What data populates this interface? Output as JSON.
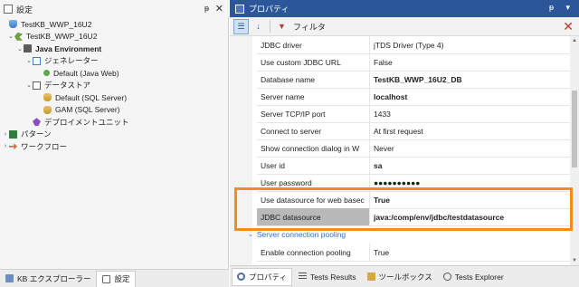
{
  "left": {
    "title": "設定",
    "pin": "ᵽ",
    "close": "✕",
    "tree": [
      {
        "label": "TestKB_WWP_16U2",
        "indent": 0,
        "chevron": "",
        "icon": "db",
        "bold": false
      },
      {
        "label": "TestKB_WWP_16U2",
        "indent": 1,
        "chevron": "⌄",
        "icon": "kbenv",
        "bold": false
      },
      {
        "label": "Java Environment",
        "indent": 2,
        "chevron": "⌄",
        "icon": "java",
        "bold": true
      },
      {
        "label": "ジェネレーター",
        "indent": 3,
        "chevron": "⌄",
        "icon": "gen",
        "bold": false
      },
      {
        "label": "Default (Java Web)",
        "indent": 4,
        "chevron": "",
        "icon": "dotgreen",
        "bold": false
      },
      {
        "label": "データストア",
        "indent": 3,
        "chevron": "⌄",
        "icon": "store",
        "bold": false
      },
      {
        "label": "Default (SQL Server)",
        "indent": 4,
        "chevron": "",
        "icon": "cyl",
        "bold": false
      },
      {
        "label": "GAM (SQL Server)",
        "indent": 4,
        "chevron": "",
        "icon": "cyl",
        "bold": false
      },
      {
        "label": "デプロイメントユニット",
        "indent": 3,
        "chevron": "",
        "icon": "deploy",
        "bold": false
      },
      {
        "label": "パターン",
        "indent": 0,
        "chevron": "›",
        "icon": "pattern",
        "bold": false
      },
      {
        "label": "ワークフロー",
        "indent": 0,
        "chevron": "›",
        "icon": "flow",
        "bold": false
      }
    ],
    "tabs": [
      {
        "label": "KB エクスプローラー",
        "active": false
      },
      {
        "label": "設定",
        "active": true
      }
    ]
  },
  "right": {
    "title": "プロパティ",
    "pin": "ᵽ",
    "dropdown": "▾",
    "toolbar": {
      "filter_label": "フィルタ",
      "close": "✕"
    },
    "rows": [
      {
        "name": "JDBC driver",
        "value": "jTDS Driver (Type 4)",
        "bold": false,
        "selected": false
      },
      {
        "name": "Use custom JDBC URL",
        "value": "False",
        "bold": false,
        "selected": false
      },
      {
        "name": "Database name",
        "value": "TestKB_WWP_16U2_DB",
        "bold": true,
        "selected": false
      },
      {
        "name": "Server name",
        "value": "localhost",
        "bold": true,
        "selected": false
      },
      {
        "name": "Server TCP/IP port",
        "value": "1433",
        "bold": false,
        "selected": false
      },
      {
        "name": "Connect to server",
        "value": "At first request",
        "bold": false,
        "selected": false
      },
      {
        "name": "Show connection dialog in W",
        "value": "Never",
        "bold": false,
        "selected": false
      },
      {
        "name": "User id",
        "value": "sa",
        "bold": true,
        "selected": false
      },
      {
        "name": "User password",
        "value": "●●●●●●●●●●",
        "bold": true,
        "selected": false
      },
      {
        "name": "Use datasource for web basec",
        "value": "True",
        "bold": true,
        "selected": false
      },
      {
        "name": "JDBC datasource",
        "value": "java:/comp/env/jdbc/testdatasource",
        "bold": true,
        "selected": true
      }
    ],
    "category": "Server connection pooling",
    "after_rows": [
      {
        "name": "Enable connection pooling",
        "value": "True",
        "bold": false,
        "selected": false
      }
    ],
    "tabs": [
      {
        "label": "プロパティ",
        "active": true,
        "icon": "gear"
      },
      {
        "label": "Tests Results",
        "active": false,
        "icon": "list"
      },
      {
        "label": "ツールボックス",
        "active": false,
        "icon": "box"
      },
      {
        "label": "Tests Explorer",
        "active": false,
        "icon": "search"
      }
    ]
  },
  "colors": {
    "title_bar": "#2b579a",
    "highlight": "#f58a1f",
    "category": "#2b74c6"
  }
}
